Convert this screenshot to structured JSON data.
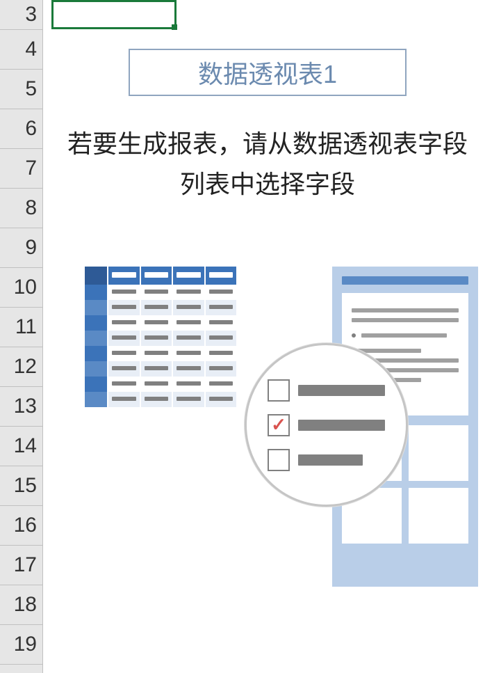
{
  "rows": [
    "3",
    "4",
    "5",
    "6",
    "7",
    "8",
    "9",
    "10",
    "11",
    "12",
    "13",
    "14",
    "15",
    "16",
    "17",
    "18",
    "19"
  ],
  "pivot": {
    "title": "数据透视表1",
    "instruction": "若要生成报表，请从数据透视表字段列表中选择字段"
  }
}
